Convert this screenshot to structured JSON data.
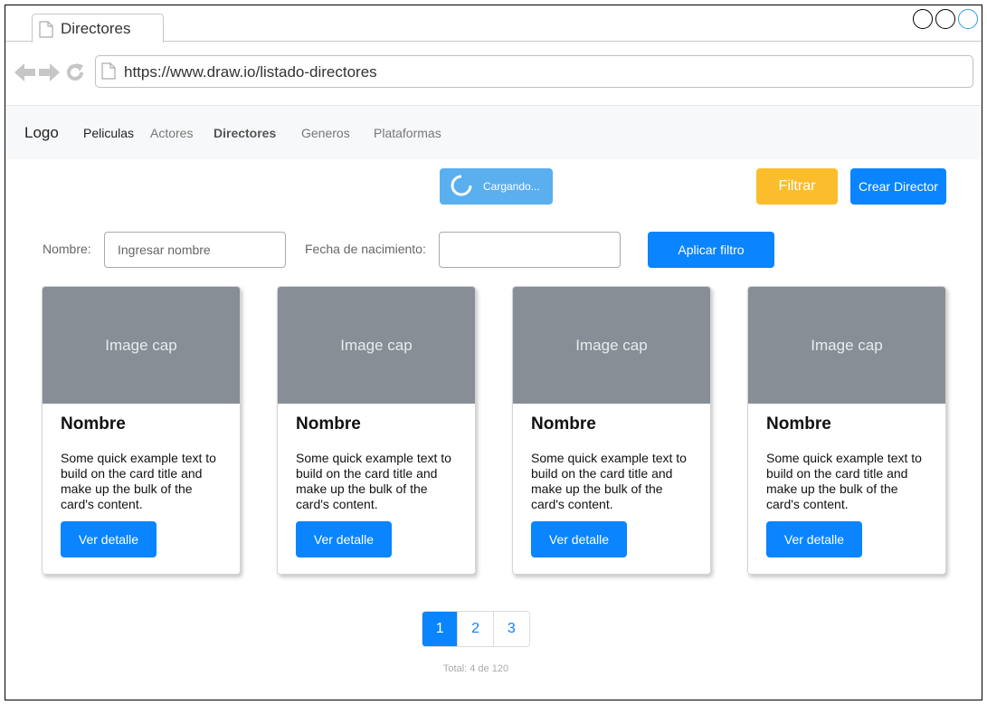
{
  "browser": {
    "tab_title": "Directores",
    "url": "https://www.draw.io/listado-directores"
  },
  "navbar": {
    "logo": "Logo",
    "links": [
      "Peliculas",
      "Actores",
      "Directores",
      "Generos",
      "Plataformas"
    ],
    "active": "Directores"
  },
  "actions": {
    "loading_label": "Cargando...",
    "filter_label": "Filtrar",
    "create_label": "Crear Director"
  },
  "filters": {
    "name_label": "Nombre:",
    "name_placeholder": "Ingresar nombre",
    "birth_label": "Fecha de nacimiento:",
    "birth_value": "",
    "apply_label": "Aplicar filtro"
  },
  "cards": [
    {
      "image": "Image cap",
      "title": "Nombre",
      "text": "Some quick example text to build on the card title and make up the bulk of the card's content.",
      "button": "Ver detalle"
    },
    {
      "image": "Image cap",
      "title": "Nombre",
      "text": "Some quick example text to build on the card title and make up the bulk of the card's content.",
      "button": "Ver detalle"
    },
    {
      "image": "Image cap",
      "title": "Nombre",
      "text": "Some quick example text to build on the card title and make up the bulk of the card's content.",
      "button": "Ver detalle"
    },
    {
      "image": "Image cap",
      "title": "Nombre",
      "text": "Some quick example text to build on the card title and make up the bulk of the card's content.",
      "button": "Ver detalle"
    }
  ],
  "pagination": {
    "pages": [
      "1",
      "2",
      "3"
    ],
    "active": "1",
    "total": "Total: 4 de 120"
  },
  "colors": {
    "primary": "#0a84ff",
    "warning": "#fbbd2c",
    "loading": "#5aafef",
    "image_cap": "#878e95"
  },
  "icons": [
    "page-icon",
    "back-arrow-icon",
    "forward-arrow-icon",
    "reload-icon",
    "spinner-icon"
  ]
}
